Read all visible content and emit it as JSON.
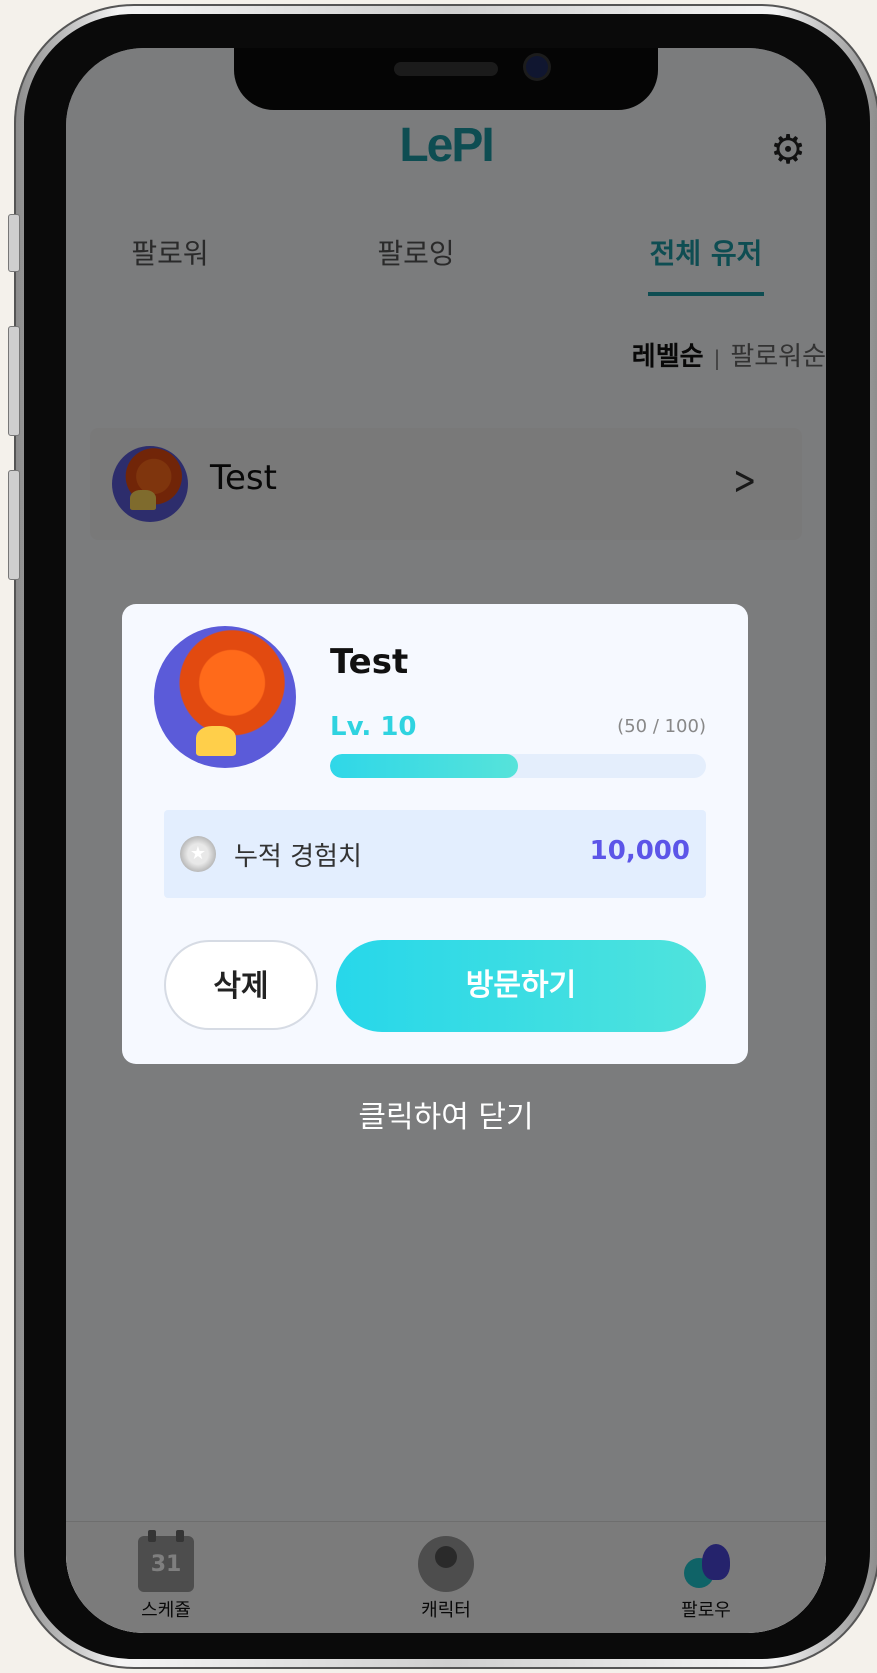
{
  "header": {
    "logo": "LePI"
  },
  "tabs": [
    {
      "label": "팔로워"
    },
    {
      "label": "팔로잉"
    },
    {
      "label": "전체 유저"
    }
  ],
  "sort": {
    "active": "레벨순",
    "other": "팔로워순"
  },
  "list": [
    {
      "name": "Test"
    }
  ],
  "modal": {
    "name": "Test",
    "level": "Lv. 10",
    "exp_text": "(50 / 100)",
    "exp_progress": 0.5,
    "stat_label": "누적 경험치",
    "stat_value": "10,000",
    "delete_label": "삭제",
    "visit_label": "방문하기"
  },
  "close_hint": "클릭하여 닫기",
  "tabbar": [
    {
      "label": "스케쥴",
      "icon": "calendar-icon",
      "badge": "31"
    },
    {
      "label": "캐릭터",
      "icon": "person-icon"
    },
    {
      "label": "팔로우",
      "icon": "follow-icon"
    }
  ],
  "colors": {
    "accent": "#1c9aa5",
    "progress": "#2fd7e8",
    "value": "#5c55e8"
  }
}
